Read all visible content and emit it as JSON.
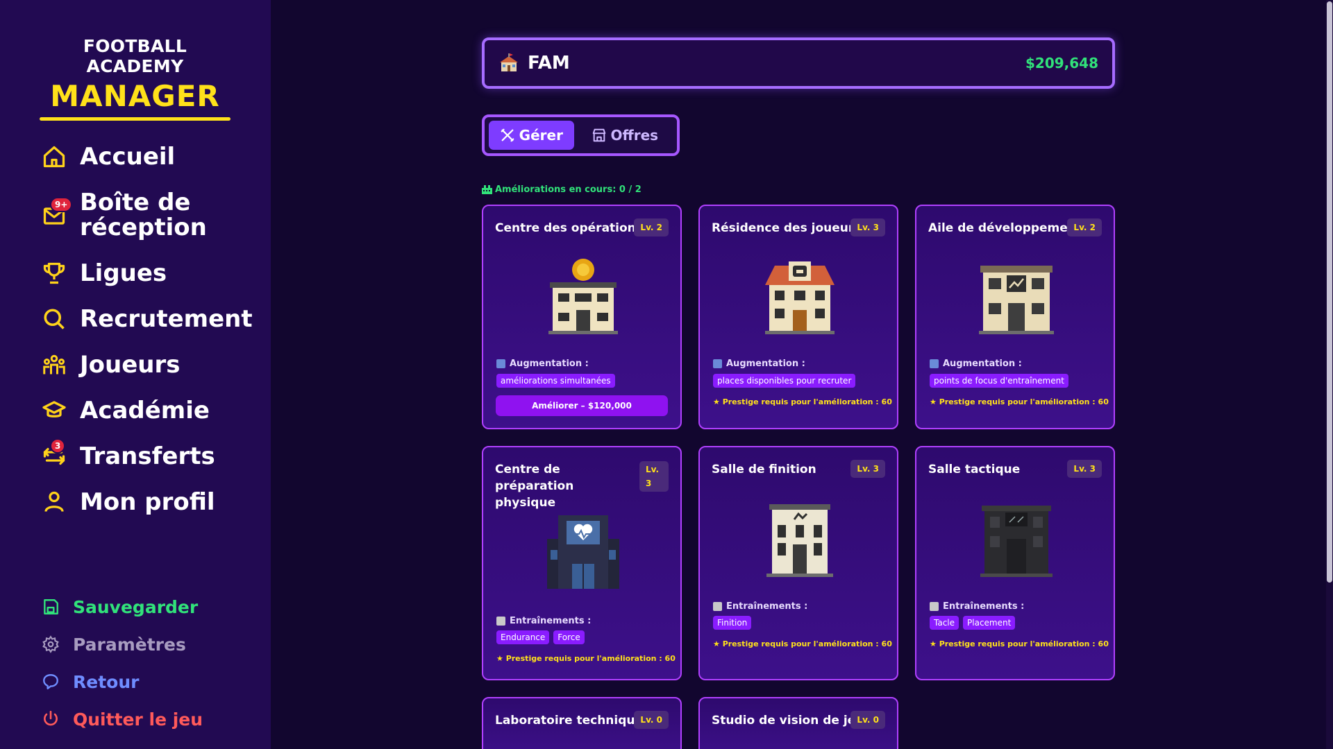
{
  "logo": {
    "top": "FOOTBALL ACADEMY",
    "main": "MANAGER"
  },
  "nav": [
    {
      "label": "Accueil",
      "icon": "home-icon"
    },
    {
      "label": "Boîte de réception",
      "icon": "mail-icon",
      "badge": "9+"
    },
    {
      "label": "Ligues",
      "icon": "trophy-icon"
    },
    {
      "label": "Recrutement",
      "icon": "search-icon"
    },
    {
      "label": "Joueurs",
      "icon": "players-icon"
    },
    {
      "label": "Académie",
      "icon": "graduation-cap-icon"
    },
    {
      "label": "Transferts",
      "icon": "transfer-icon",
      "badge": "3"
    },
    {
      "label": "Mon profil",
      "icon": "user-icon"
    }
  ],
  "bottom_nav": [
    {
      "label": "Sauvegarder",
      "icon": "save-icon",
      "color": "#31e27a"
    },
    {
      "label": "Paramètres",
      "icon": "settings-icon",
      "color": "#a89cc0"
    },
    {
      "label": "Retour",
      "icon": "feedback-icon",
      "color": "#6f8dff"
    },
    {
      "label": "Quitter le jeu",
      "icon": "power-icon",
      "color": "#ff5a5a"
    }
  ],
  "header": {
    "club_name": "FAM",
    "money": "$209,648"
  },
  "tabs": {
    "manage": "Gérer",
    "offers": "Offres"
  },
  "upgrades_in_progress": "Améliorations en cours: 0 / 2",
  "cards": [
    {
      "title": "Centre des opérations",
      "level": "Lv. 2",
      "section": "Augmentation :",
      "chips": [
        "améliorations simultanées"
      ],
      "button": "Améliorer – $120,000"
    },
    {
      "title": "Résidence des joueurs",
      "level": "Lv. 3",
      "section": "Augmentation :",
      "chips": [
        "places disponibles pour recruter"
      ],
      "prestige": "★ Prestige requis pour l'amélioration : 60"
    },
    {
      "title": "Aile de développement",
      "level": "Lv. 2",
      "section": "Augmentation :",
      "chips": [
        "points de focus d'entraînement"
      ],
      "prestige": "★ Prestige requis pour l'amélioration : 60"
    },
    {
      "title": "Centre de préparation physique",
      "level": "Lv. 3",
      "section": "Entraînements :",
      "chips": [
        "Endurance",
        "Force"
      ],
      "prestige": "★ Prestige requis pour l'amélioration : 60"
    },
    {
      "title": "Salle de finition",
      "level": "Lv. 3",
      "section": "Entraînements :",
      "chips": [
        "Finition"
      ],
      "prestige": "★ Prestige requis pour l'amélioration : 60"
    },
    {
      "title": "Salle tactique",
      "level": "Lv. 3",
      "section": "Entraînements :",
      "chips": [
        "Tacle",
        "Placement"
      ],
      "prestige": "★ Prestige requis pour l'amélioration : 60"
    },
    {
      "title": "Laboratoire technique",
      "level": "Lv. 0"
    },
    {
      "title": "Studio de vision de jeu",
      "level": "Lv. 0"
    }
  ]
}
